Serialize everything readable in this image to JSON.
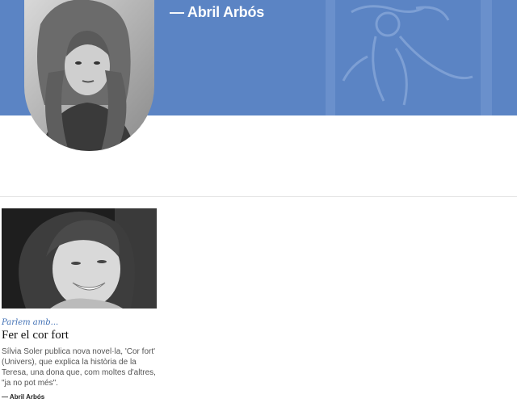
{
  "header": {
    "author_name": "— Abril Arbós",
    "brand_color": "#5b84c4"
  },
  "article": {
    "kicker": "Parlem amb...",
    "title": "Fer el cor fort",
    "summary": "Sílvia Soler publica nova novel·la, 'Cor fort' (Univers), que explica la història de la Teresa, una dona que, com moltes d'altres, \"ja no pot més\".",
    "byline": "— Abril Arbós"
  }
}
